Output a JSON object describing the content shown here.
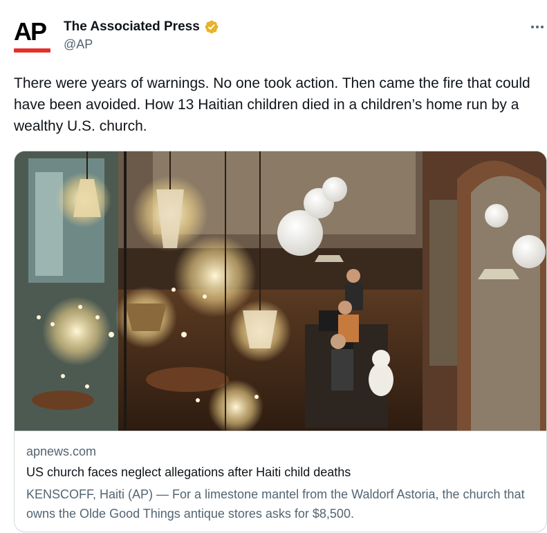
{
  "author": {
    "display_name": "The Associated Press",
    "handle": "@AP",
    "avatar_logo_text": "AP",
    "verified": true,
    "verified_color": "#e8b32b",
    "brand_red": "#e4322b"
  },
  "tweet": {
    "text": "There were years of warnings. No one took action. Then came the fire that could have been avoided. How 13 Haitian children died in a children’s home run by a wealthy U.S. church."
  },
  "card": {
    "image_icon": "antique-store-photo",
    "domain": "apnews.com",
    "title": "US church faces neglect allegations after Haiti child deaths",
    "description": "KENSCOFF, Haiti (AP) — For a limestone mantel from the Waldorf Astoria, the church that owns the Olde Good Things antique stores asks for $8,500."
  },
  "icons": {
    "more": "more-options-icon",
    "verified": "verified-badge-icon"
  }
}
